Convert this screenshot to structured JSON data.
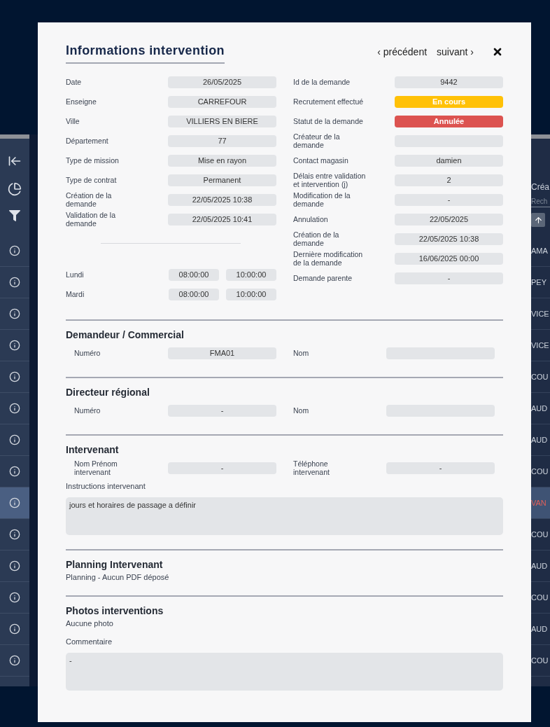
{
  "background": {
    "table": {
      "header": "Créa",
      "search_placeholder": "Rech"
    },
    "rows": [
      {
        "text": "AMA",
        "selected": false
      },
      {
        "text": "PEY",
        "selected": false
      },
      {
        "text": "VICE",
        "selected": false
      },
      {
        "text": "VICE",
        "selected": false
      },
      {
        "text": "COU",
        "selected": false
      },
      {
        "text": "AUD",
        "selected": false
      },
      {
        "text": "AUD",
        "selected": false
      },
      {
        "text": "COU",
        "selected": false
      },
      {
        "text": "VAN",
        "selected": true
      },
      {
        "text": "COU",
        "selected": false
      },
      {
        "text": "AUD",
        "selected": false
      },
      {
        "text": "COU",
        "selected": false
      },
      {
        "text": "AUD",
        "selected": false
      },
      {
        "text": "COU",
        "selected": false
      }
    ]
  },
  "modal": {
    "title": "Informations intervention",
    "previous": "‹ précédent",
    "next": "suivant ›",
    "left_fields": [
      {
        "label": "Date",
        "value": "26/05/2025"
      },
      {
        "label": "Enseigne",
        "value": "CARREFOUR"
      },
      {
        "label": "Ville",
        "value": "VILLIERS EN BIERE"
      },
      {
        "label": "Département",
        "value": "77"
      },
      {
        "label": "Type de mission",
        "value": "Mise en rayon"
      },
      {
        "label": "Type de contrat",
        "value": "Permanent"
      },
      {
        "label": "Création de la demande",
        "value": "22/05/2025 10:38"
      },
      {
        "label": "Validation de la demande",
        "value": "22/05/2025 10:41"
      }
    ],
    "schedule": [
      {
        "day": "Lundi",
        "start": "08:00:00",
        "end": "10:00:00"
      },
      {
        "day": "Mardi",
        "start": "08:00:00",
        "end": "10:00:00"
      }
    ],
    "right_fields": [
      {
        "label": "Id de la demande",
        "value": "9442",
        "kind": "plain"
      },
      {
        "label": "Recrutement effectué",
        "value": "En cours",
        "kind": "status",
        "color": "#ffc107"
      },
      {
        "label": "Statut de la demande",
        "value": "Annulée",
        "kind": "status",
        "color": "#dc5350"
      },
      {
        "label": "Créateur de la demande",
        "kind": "plain"
      },
      {
        "label": "Contact magasin",
        "value": "damien",
        "kind": "plain"
      },
      {
        "label": "Délais entre validation et intervention (j)",
        "value": "2",
        "kind": "plain"
      },
      {
        "label": "Modification de la demande",
        "value": "-",
        "kind": "plain"
      },
      {
        "label": "Annulation",
        "value": "22/05/2025",
        "kind": "plain"
      },
      {
        "label": "Création de la demande",
        "value": "22/05/2025 10:38",
        "kind": "plain"
      },
      {
        "label": "Dernière modification de la demande",
        "value": "16/06/2025 00:00",
        "kind": "plain"
      },
      {
        "label": "Demande parente",
        "value": "-",
        "kind": "plain"
      }
    ],
    "sections": [
      {
        "title": "Demandeur / Commercial",
        "items": [
          {
            "kind": "pair",
            "left": {
              "label": "Numéro",
              "value": "FMA01"
            },
            "right": {
              "label": "Nom"
            }
          }
        ]
      },
      {
        "title": "Directeur régional",
        "items": [
          {
            "kind": "pair",
            "left": {
              "label": "Numéro",
              "value": "-"
            },
            "right": {
              "label": "Nom"
            }
          }
        ]
      },
      {
        "title": "Intervenant",
        "items": [
          {
            "kind": "pair",
            "left": {
              "label": "Nom Prénom intervenant",
              "value": "-"
            },
            "right": {
              "label": "Téléphone intervenant",
              "value": "-"
            }
          },
          {
            "kind": "textbox",
            "label": "Instructions intervenant",
            "value": "jours et horaires de passage a définir"
          }
        ]
      },
      {
        "title": "Planning Intervenant",
        "items": [
          {
            "kind": "note",
            "text": "Planning - Aucun PDF déposé"
          }
        ]
      },
      {
        "title": "Photos interventions",
        "items": [
          {
            "kind": "note",
            "text": "Aucune photo"
          },
          {
            "kind": "textbox",
            "label": "Commentaire",
            "value": "-"
          }
        ]
      }
    ]
  }
}
